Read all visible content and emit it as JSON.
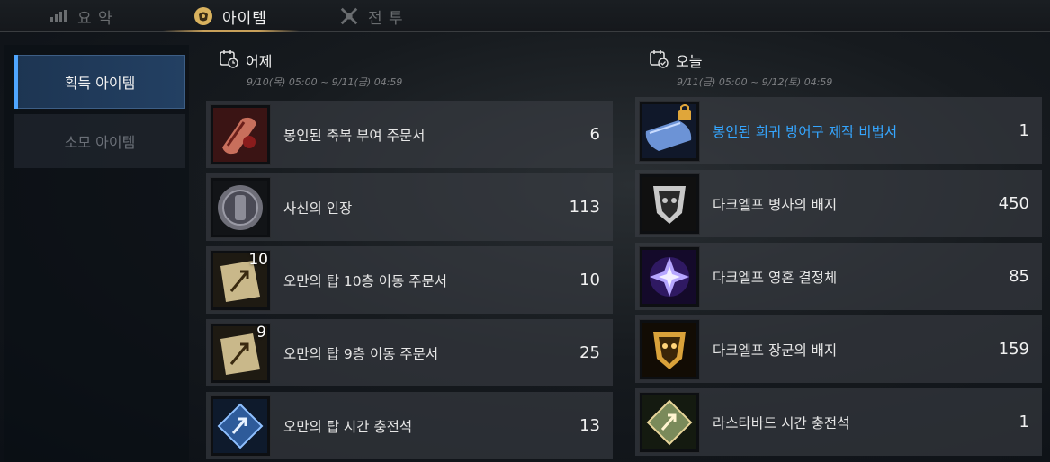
{
  "tabs": [
    {
      "label": "요 약",
      "icon": "chart-bars-icon",
      "active": false
    },
    {
      "label": "아이템",
      "icon": "item-pouch-icon",
      "active": true
    },
    {
      "label": "전 투",
      "icon": "crossed-swords-icon",
      "active": false
    }
  ],
  "sidebar": {
    "items": [
      {
        "label": "획득 아이템",
        "active": true
      },
      {
        "label": "소모 아이템",
        "active": false
      }
    ]
  },
  "yesterday": {
    "title": "어제",
    "range": "9/10(목) 05:00 ~ 9/11(금) 04:59",
    "items": [
      {
        "name": "봉인된 축복 부여 주문서",
        "count": "6",
        "icon": "sealed-scroll-icon"
      },
      {
        "name": "사신의 인장",
        "count": "113",
        "icon": "reaper-seal-icon"
      },
      {
        "name": "오만의 탑 10층 이동 주문서",
        "count": "10",
        "icon": "teleport-scroll-icon",
        "badge": "10"
      },
      {
        "name": "오만의 탑 9층 이동 주문서",
        "count": "25",
        "icon": "teleport-scroll-icon",
        "badge": "9"
      },
      {
        "name": "오만의 탑 시간 충전석",
        "count": "13",
        "icon": "time-charge-stone-icon"
      }
    ]
  },
  "today": {
    "title": "오늘",
    "range": "9/11(금) 05:00 ~ 9/12(토) 04:59",
    "items": [
      {
        "name": "봉인된 희귀 방어구 제작 비법서",
        "count": "1",
        "icon": "locked-recipe-icon",
        "rare": true
      },
      {
        "name": "다크엘프 병사의 배지",
        "count": "450",
        "icon": "soldier-badge-icon"
      },
      {
        "name": "다크엘프 영혼 결정체",
        "count": "85",
        "icon": "soul-crystal-icon"
      },
      {
        "name": "다크엘프 장군의 배지",
        "count": "159",
        "icon": "general-badge-icon"
      },
      {
        "name": "라스타바드 시간 충전석",
        "count": "1",
        "icon": "time-charge-stone-icon"
      }
    ]
  },
  "colors": {
    "accent_blue": "#4fa6ff",
    "rare_text": "#35a6ff",
    "tab_gold": "#c8a05a"
  }
}
